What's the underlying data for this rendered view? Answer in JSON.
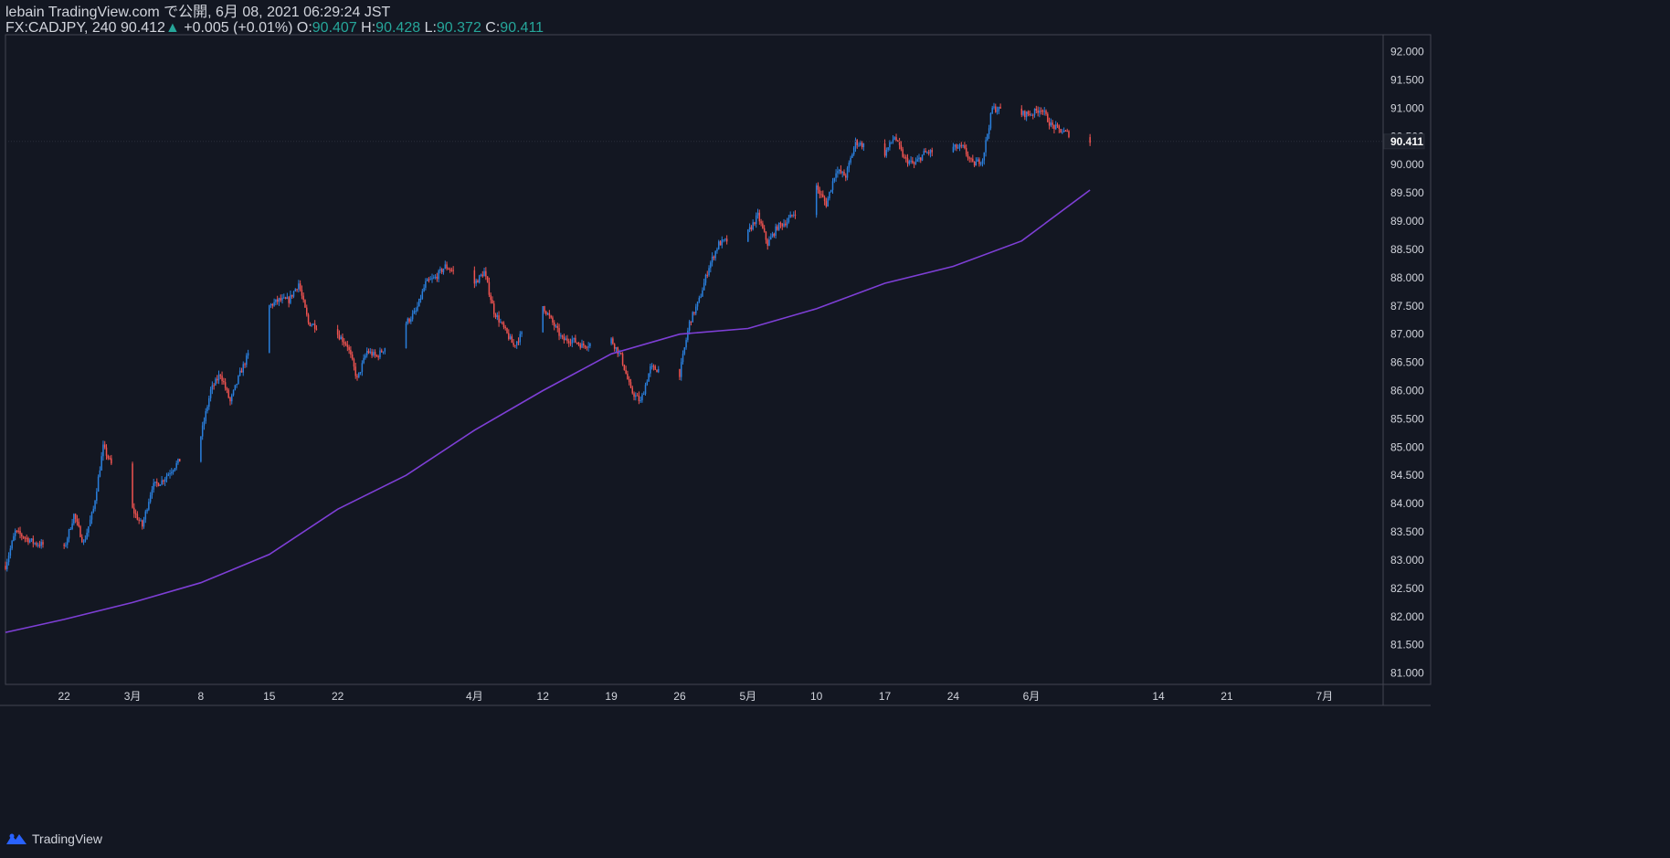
{
  "header": {
    "published": "lebain TradingView.com で公開, 6月 08, 2021 06:29:24 JST",
    "symbol": "FX:CADJPY, 240",
    "last": "90.412",
    "change_arrow": "▲",
    "change": "+0.005 (+0.01%)",
    "o_label": "O:",
    "o": "90.407",
    "h_label": "H:",
    "h": "90.428",
    "l_label": "L:",
    "l": "90.372",
    "c_label": "C:",
    "c": "90.411"
  },
  "brand": {
    "name": "TradingView",
    "icon": "tradingview-logo-icon"
  },
  "colors": {
    "background": "#131722",
    "up": "#2a7fdc",
    "down": "#ef5350",
    "ma": "#7e3fd6",
    "text": "#d1d4dc",
    "axis_line": "#434651",
    "ohlc_value": "#26a69a"
  },
  "chart_data": {
    "type": "candlestick",
    "series": [
      {
        "name": "CADJPY 240"
      },
      {
        "name": "moving average"
      }
    ],
    "ylim": [
      80.8,
      92.3
    ],
    "yticks": [
      "92.000",
      "91.500",
      "91.000",
      "90.500",
      "90.000",
      "89.500",
      "89.000",
      "88.500",
      "88.000",
      "87.500",
      "87.000",
      "86.500",
      "86.000",
      "85.500",
      "85.000",
      "84.500",
      "84.000",
      "83.500",
      "83.000",
      "82.500",
      "82.000",
      "81.500",
      "81.000"
    ],
    "current_price_label": "90.411",
    "current_price": 90.411,
    "xticks": [
      "22",
      "3月",
      "8",
      "15",
      "22",
      "4月",
      "12",
      "19",
      "26",
      "5月",
      "10",
      "17",
      "24",
      "6月",
      "14",
      "21",
      "7月"
    ],
    "x_range_days": [
      "2021-02-16",
      "2021-07-07"
    ],
    "xtick_dates": [
      "2021-02-22",
      "2021-03-01",
      "2021-03-08",
      "2021-03-15",
      "2021-03-22",
      "2021-04-05",
      "2021-04-12",
      "2021-04-19",
      "2021-04-26",
      "2021-05-03",
      "2021-05-10",
      "2021-05-17",
      "2021-05-24",
      "2021-06-01",
      "2021-06-14",
      "2021-06-21",
      "2021-07-01"
    ],
    "price_path": [
      [
        "2021-02-16",
        82.9
      ],
      [
        "2021-02-17",
        83.5
      ],
      [
        "2021-02-18",
        83.4
      ],
      [
        "2021-02-19",
        83.3
      ],
      [
        "2021-02-22",
        83.2
      ],
      [
        "2021-02-23",
        83.8
      ],
      [
        "2021-02-24",
        83.3
      ],
      [
        "2021-02-25",
        83.9
      ],
      [
        "2021-02-26",
        85.0
      ],
      [
        "2021-03-01",
        83.9
      ],
      [
        "2021-03-02",
        83.6
      ],
      [
        "2021-03-03",
        84.3
      ],
      [
        "2021-03-04",
        84.4
      ],
      [
        "2021-03-05",
        84.6
      ],
      [
        "2021-03-08",
        85.2
      ],
      [
        "2021-03-09",
        86.0
      ],
      [
        "2021-03-10",
        86.3
      ],
      [
        "2021-03-11",
        85.8
      ],
      [
        "2021-03-12",
        86.3
      ],
      [
        "2021-03-15",
        87.5
      ],
      [
        "2021-03-16",
        87.6
      ],
      [
        "2021-03-17",
        87.6
      ],
      [
        "2021-03-18",
        87.9
      ],
      [
        "2021-03-19",
        87.2
      ],
      [
        "2021-03-22",
        87.0
      ],
      [
        "2021-03-23",
        86.8
      ],
      [
        "2021-03-24",
        86.2
      ],
      [
        "2021-03-25",
        86.7
      ],
      [
        "2021-03-26",
        86.6
      ],
      [
        "2021-03-29",
        87.2
      ],
      [
        "2021-03-30",
        87.4
      ],
      [
        "2021-03-31",
        87.9
      ],
      [
        "2021-04-01",
        88.0
      ],
      [
        "2021-04-02",
        88.2
      ],
      [
        "2021-04-05",
        87.9
      ],
      [
        "2021-04-06",
        88.1
      ],
      [
        "2021-04-07",
        87.4
      ],
      [
        "2021-04-08",
        87.1
      ],
      [
        "2021-04-09",
        86.8
      ],
      [
        "2021-04-12",
        87.5
      ],
      [
        "2021-04-13",
        87.2
      ],
      [
        "2021-04-14",
        86.9
      ],
      [
        "2021-04-15",
        86.9
      ],
      [
        "2021-04-16",
        86.8
      ],
      [
        "2021-04-19",
        86.9
      ],
      [
        "2021-04-20",
        86.6
      ],
      [
        "2021-04-21",
        86.0
      ],
      [
        "2021-04-22",
        85.8
      ],
      [
        "2021-04-23",
        86.4
      ],
      [
        "2021-04-26",
        86.3
      ],
      [
        "2021-04-27",
        87.2
      ],
      [
        "2021-04-28",
        87.6
      ],
      [
        "2021-04-29",
        88.2
      ],
      [
        "2021-04-30",
        88.6
      ],
      [
        "2021-05-03",
        88.8
      ],
      [
        "2021-05-04",
        89.1
      ],
      [
        "2021-05-05",
        88.6
      ],
      [
        "2021-05-06",
        88.9
      ],
      [
        "2021-05-07",
        89.0
      ],
      [
        "2021-05-10",
        89.6
      ],
      [
        "2021-05-11",
        89.3
      ],
      [
        "2021-05-12",
        89.9
      ],
      [
        "2021-05-13",
        89.8
      ],
      [
        "2021-05-14",
        90.4
      ],
      [
        "2021-05-17",
        90.2
      ],
      [
        "2021-05-18",
        90.5
      ],
      [
        "2021-05-19",
        90.1
      ],
      [
        "2021-05-20",
        90.0
      ],
      [
        "2021-05-21",
        90.2
      ],
      [
        "2021-05-24",
        90.3
      ],
      [
        "2021-05-25",
        90.3
      ],
      [
        "2021-05-26",
        90.0
      ],
      [
        "2021-05-27",
        90.1
      ],
      [
        "2021-05-28",
        91.0
      ],
      [
        "2021-05-31",
        90.9
      ],
      [
        "2021-06-01",
        90.9
      ],
      [
        "2021-06-02",
        91.0
      ],
      [
        "2021-06-03",
        90.7
      ],
      [
        "2021-06-04",
        90.6
      ],
      [
        "2021-06-07",
        90.4
      ]
    ],
    "ma_path": [
      [
        "2021-02-16",
        81.72
      ],
      [
        "2021-02-22",
        81.95
      ],
      [
        "2021-03-01",
        82.25
      ],
      [
        "2021-03-08",
        82.6
      ],
      [
        "2021-03-15",
        83.1
      ],
      [
        "2021-03-22",
        83.9
      ],
      [
        "2021-03-29",
        84.5
      ],
      [
        "2021-04-05",
        85.3
      ],
      [
        "2021-04-12",
        86.0
      ],
      [
        "2021-04-19",
        86.65
      ],
      [
        "2021-04-26",
        87.0
      ],
      [
        "2021-05-03",
        87.1
      ],
      [
        "2021-05-10",
        87.45
      ],
      [
        "2021-05-17",
        87.9
      ],
      [
        "2021-05-24",
        88.2
      ],
      [
        "2021-05-31",
        88.65
      ],
      [
        "2021-06-07",
        89.55
      ]
    ]
  }
}
